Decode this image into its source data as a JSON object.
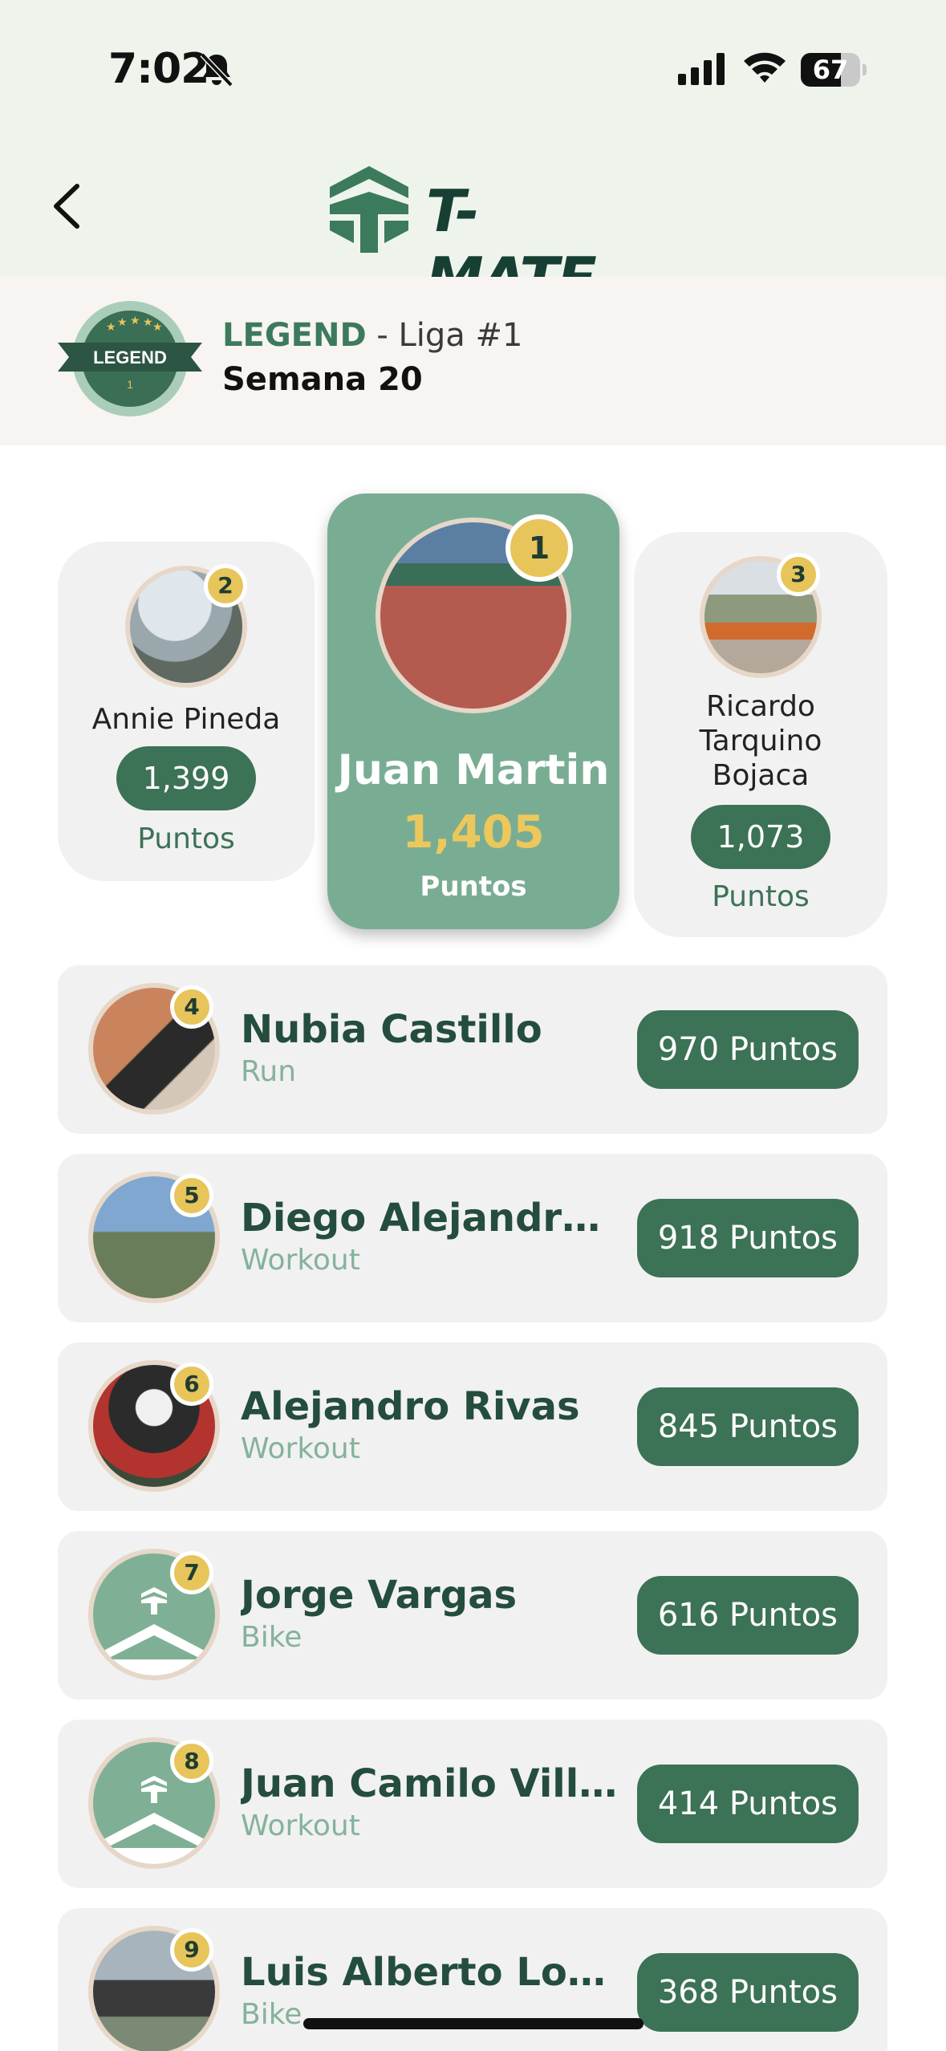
{
  "status_bar": {
    "time": "7:02",
    "battery": "67",
    "battery_level": 0.67
  },
  "header": {
    "logo_text": "T-MATE"
  },
  "league": {
    "badge_text": "LEGEND",
    "badge_level": "1",
    "tier": "LEGEND",
    "liga": " - Liga #1",
    "week": "Semana 20"
  },
  "podium": [
    {
      "rank": "1",
      "name": "Juan Martin",
      "points": "1,405",
      "label": "Puntos"
    },
    {
      "rank": "2",
      "name": "Annie Pineda",
      "points": "1,399",
      "label": "Puntos"
    },
    {
      "rank": "3",
      "name": "Ricardo Tarquino Bojaca",
      "points": "1,073",
      "label": "Puntos"
    }
  ],
  "ranking": [
    {
      "rank": "4",
      "name": "Nubia  Castillo",
      "sport": "Run",
      "points": "970 Puntos"
    },
    {
      "rank": "5",
      "name": "Diego Alejandro F...",
      "sport": "Workout",
      "points": "918 Puntos"
    },
    {
      "rank": "6",
      "name": "Alejandro  Rivas",
      "sport": "Workout",
      "points": "845 Puntos"
    },
    {
      "rank": "7",
      "name": "Jorge Vargas",
      "sport": "Bike",
      "points": "616 Puntos"
    },
    {
      "rank": "8",
      "name": "Juan Camilo Villa...",
      "sport": "Workout",
      "points": "414 Puntos"
    },
    {
      "rank": "9",
      "name": "Luis Alberto  Lover...",
      "sport": "Bike",
      "points": "368 Puntos"
    }
  ]
}
